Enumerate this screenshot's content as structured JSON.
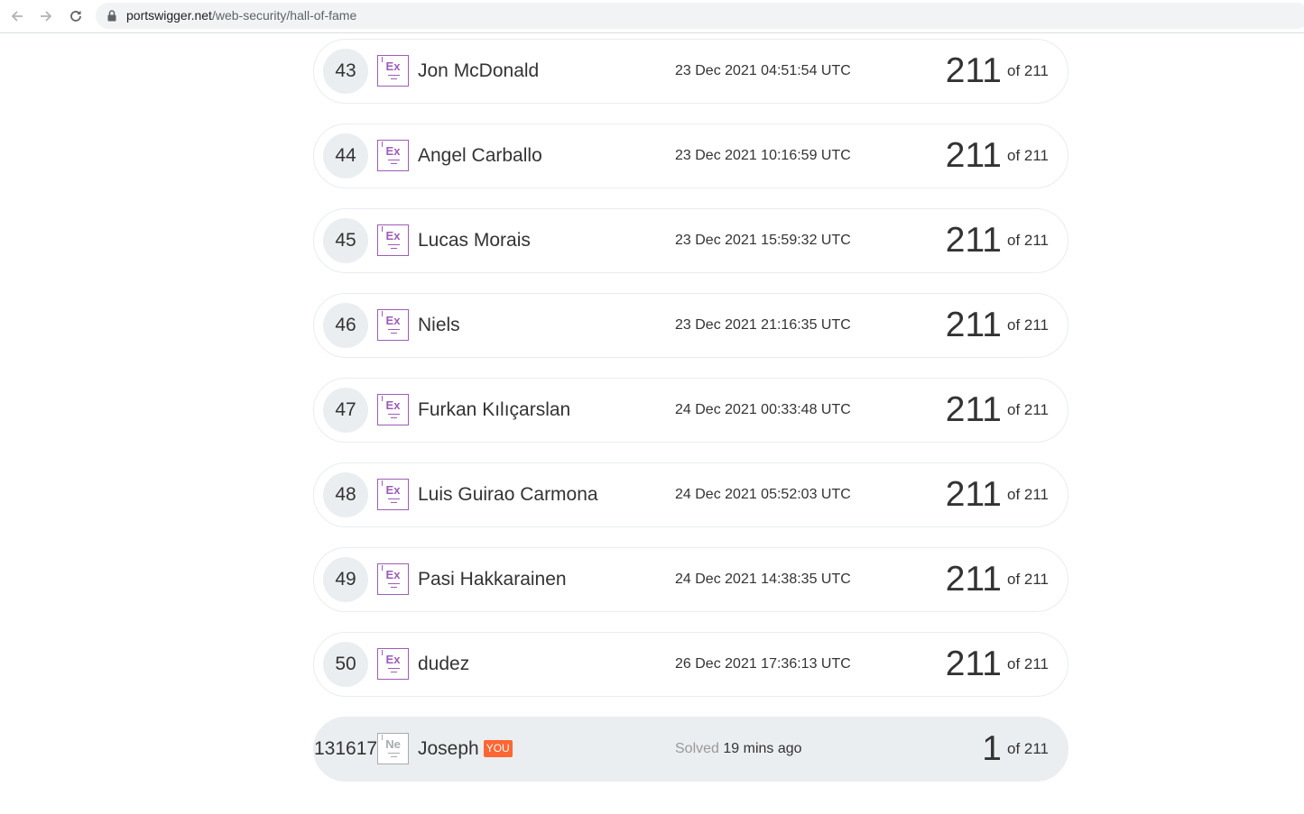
{
  "browser": {
    "url_host": "portswigger.net",
    "url_path": "/web-security/hall-of-fame",
    "back_icon": "arrow-left-icon",
    "forward_icon": "arrow-right-icon",
    "reload_icon": "reload-icon",
    "lock_icon": "lock-icon"
  },
  "colors": {
    "expert_badge": "#9e5cb8",
    "new_badge": "#a7acae",
    "you_tag": "#ff6633",
    "row_highlight": "#eaeef0"
  },
  "rows": [
    {
      "rank": "43",
      "badge": "Ex",
      "name": "Jon McDonald",
      "date": "23 Dec 2021 04:51:54 UTC",
      "score": "211",
      "of": "of 211"
    },
    {
      "rank": "44",
      "badge": "Ex",
      "name": "Angel Carballo",
      "date": "23 Dec 2021 10:16:59 UTC",
      "score": "211",
      "of": "of 211"
    },
    {
      "rank": "45",
      "badge": "Ex",
      "name": "Lucas Morais",
      "date": "23 Dec 2021 15:59:32 UTC",
      "score": "211",
      "of": "of 211"
    },
    {
      "rank": "46",
      "badge": "Ex",
      "name": "Niels",
      "date": "23 Dec 2021 21:16:35 UTC",
      "score": "211",
      "of": "of 211"
    },
    {
      "rank": "47",
      "badge": "Ex",
      "name": "Furkan Kılıçarslan",
      "date": "24 Dec 2021 00:33:48 UTC",
      "score": "211",
      "of": "of 211"
    },
    {
      "rank": "48",
      "badge": "Ex",
      "name": "Luis Guirao Carmona",
      "date": "24 Dec 2021 05:52:03 UTC",
      "score": "211",
      "of": "of 211"
    },
    {
      "rank": "49",
      "badge": "Ex",
      "name": "Pasi Hakkarainen",
      "date": "24 Dec 2021 14:38:35 UTC",
      "score": "211",
      "of": "of 211"
    },
    {
      "rank": "50",
      "badge": "Ex",
      "name": "dudez",
      "date": "26 Dec 2021 17:36:13 UTC",
      "score": "211",
      "of": "of 211"
    }
  ],
  "me": {
    "rank": "131617",
    "badge": "Ne",
    "name": "Joseph",
    "you_label": "YOU",
    "solved_label": "Solved",
    "solved_ago": "19 mins ago",
    "score": "1",
    "of": "of 211"
  }
}
